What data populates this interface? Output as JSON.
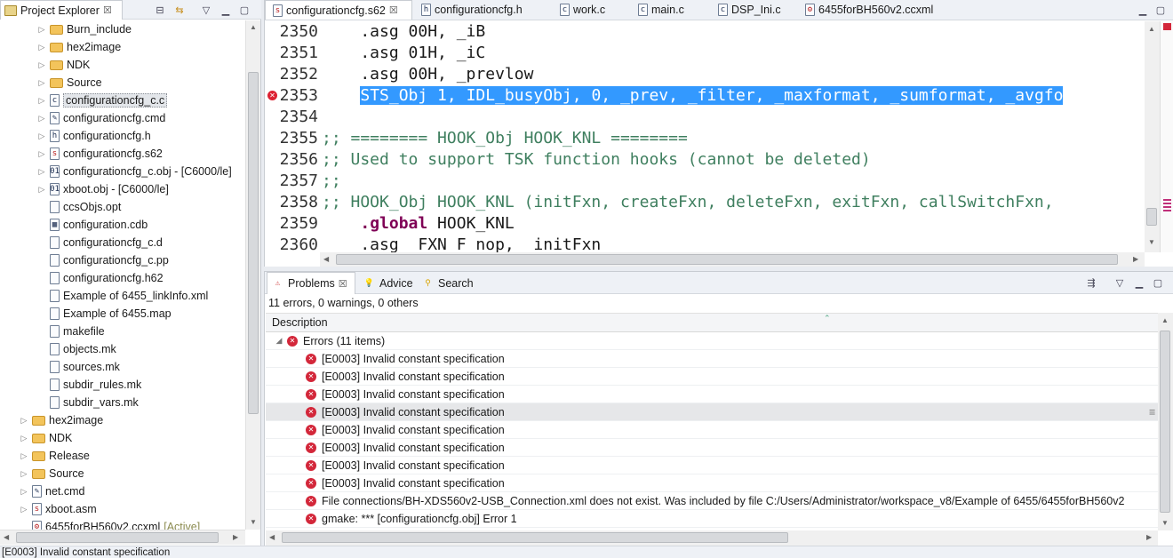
{
  "explorer": {
    "tab_label": "Project Explorer",
    "items": [
      {
        "label": "Burn_include",
        "kind": "folder",
        "expand": "▷"
      },
      {
        "label": "hex2image",
        "kind": "folder",
        "expand": "▷"
      },
      {
        "label": "NDK",
        "kind": "folder",
        "expand": "▷"
      },
      {
        "label": "Source",
        "kind": "folder",
        "expand": "▷"
      },
      {
        "label": "configurationcfg_c.c",
        "kind": "file-c",
        "expand": "▷",
        "selected": true
      },
      {
        "label": "configurationcfg.cmd",
        "kind": "file-cmd",
        "expand": "▷"
      },
      {
        "label": "configurationcfg.h",
        "kind": "file-h",
        "expand": "▷"
      },
      {
        "label": "configurationcfg.s62",
        "kind": "file-s",
        "expand": "▷"
      },
      {
        "label": "configurationcfg_c.obj - [C6000/le]",
        "kind": "file-obj",
        "expand": "▷"
      },
      {
        "label": "xboot.obj - [C6000/le]",
        "kind": "file-obj",
        "expand": "▷"
      },
      {
        "label": "ccsObjs.opt",
        "kind": "file",
        "expand": ""
      },
      {
        "label": "configuration.cdb",
        "kind": "file-cdb",
        "expand": ""
      },
      {
        "label": "configurationcfg_c.d",
        "kind": "file",
        "expand": ""
      },
      {
        "label": "configurationcfg_c.pp",
        "kind": "file",
        "expand": ""
      },
      {
        "label": "configurationcfg.h62",
        "kind": "file",
        "expand": ""
      },
      {
        "label": "Example of 6455_linkInfo.xml",
        "kind": "file",
        "expand": ""
      },
      {
        "label": "Example of 6455.map",
        "kind": "file",
        "expand": ""
      },
      {
        "label": "makefile",
        "kind": "file",
        "expand": ""
      },
      {
        "label": "objects.mk",
        "kind": "file",
        "expand": ""
      },
      {
        "label": "sources.mk",
        "kind": "file",
        "expand": ""
      },
      {
        "label": "subdir_rules.mk",
        "kind": "file",
        "expand": ""
      },
      {
        "label": "subdir_vars.mk",
        "kind": "file",
        "expand": ""
      },
      {
        "label": "hex2image",
        "kind": "folder",
        "expand": "▷",
        "level": 1
      },
      {
        "label": "NDK",
        "kind": "folder",
        "expand": "▷",
        "level": 1
      },
      {
        "label": "Release",
        "kind": "folder",
        "expand": "▷",
        "level": 1
      },
      {
        "label": "Source",
        "kind": "folder",
        "expand": "▷",
        "level": 1
      },
      {
        "label": "net.cmd",
        "kind": "file-cmd",
        "expand": "▷",
        "level": 1
      },
      {
        "label": "xboot.asm",
        "kind": "file-s",
        "expand": "▷",
        "level": 1
      },
      {
        "label": "6455forBH560v2.ccxml",
        "kind": "file-ccxml",
        "expand": "",
        "level": 1,
        "tag": "[Active]"
      }
    ]
  },
  "editor": {
    "tabs": [
      {
        "label": "configurationcfg.s62",
        "icon": "asm-file-icon",
        "active": true,
        "close": "☒"
      },
      {
        "label": "configurationcfg.h",
        "icon": "h-file-icon"
      },
      {
        "label": "work.c",
        "icon": "c-file-icon"
      },
      {
        "label": "main.c",
        "icon": "c-file-icon"
      },
      {
        "label": "DSP_Ini.c",
        "icon": "c-file-icon"
      },
      {
        "label": "6455forBH560v2.ccxml",
        "icon": "ccxml-file-icon"
      }
    ],
    "lines": [
      {
        "num": "2350",
        "text": "    .asg 00H, _iB",
        "style": "plain"
      },
      {
        "num": "2351",
        "text": "    .asg 01H, _iC",
        "style": "plain"
      },
      {
        "num": "2352",
        "text": "    .asg 00H, _prevlow",
        "style": "plain"
      },
      {
        "num": "2353",
        "text": "    STS_Obj 1, IDL_busyObj, 0, _prev, _filter, _maxformat, _sumformat, _avgfo",
        "style": "highlight",
        "error": true
      },
      {
        "num": "2354",
        "text": "",
        "style": "plain"
      },
      {
        "num": "2355",
        "text": ";; ======== HOOK_Obj HOOK_KNL ========",
        "style": "comment"
      },
      {
        "num": "2356",
        "text": ";; Used to support TSK function hooks (cannot be deleted)",
        "style": "comment"
      },
      {
        "num": "2357",
        "text": ";;",
        "style": "comment"
      },
      {
        "num": "2358",
        "text": ";; HOOK_Obj HOOK_KNL (initFxn, createFxn, deleteFxn, exitFxn, callSwitchFxn,",
        "style": "comment"
      },
      {
        "num": "2359",
        "kw": ".global",
        "text": " HOOK_KNL",
        "style": "keyword"
      },
      {
        "num": "2360",
        "text": "    .asg _FXN_F_nop, _initFxn",
        "style": "plain"
      }
    ]
  },
  "problems": {
    "tabs": [
      {
        "label": "Problems",
        "icon": "problems-icon",
        "active": true
      },
      {
        "label": "Advice",
        "icon": "lightbulb-icon"
      },
      {
        "label": "Search",
        "icon": "search-icon"
      }
    ],
    "summary": "11 errors, 0 warnings, 0 others",
    "column_header": "Description",
    "group": {
      "label": "Errors (11 items)",
      "expand": "◢"
    },
    "items": [
      {
        "text": "[E0003] Invalid constant specification"
      },
      {
        "text": "[E0003] Invalid constant specification"
      },
      {
        "text": "[E0003] Invalid constant specification"
      },
      {
        "text": "[E0003] Invalid constant specification",
        "selected": true
      },
      {
        "text": "[E0003] Invalid constant specification"
      },
      {
        "text": "[E0003] Invalid constant specification"
      },
      {
        "text": "[E0003] Invalid constant specification"
      },
      {
        "text": "[E0003] Invalid constant specification"
      },
      {
        "text": "File connections/BH-XDS560v2-USB_Connection.xml does not exist.  Was included by file C:/Users/Administrator/workspace_v8/Example of 6455/6455forBH560v2"
      },
      {
        "text": "gmake: *** [configurationcfg.obj] Error 1"
      }
    ]
  },
  "status_text": "[E0003] Invalid constant specification",
  "colors": {
    "selection": "#3399ff",
    "comment": "#3f7f5f",
    "keyword": "#7f0055",
    "error": "#d3273a"
  }
}
